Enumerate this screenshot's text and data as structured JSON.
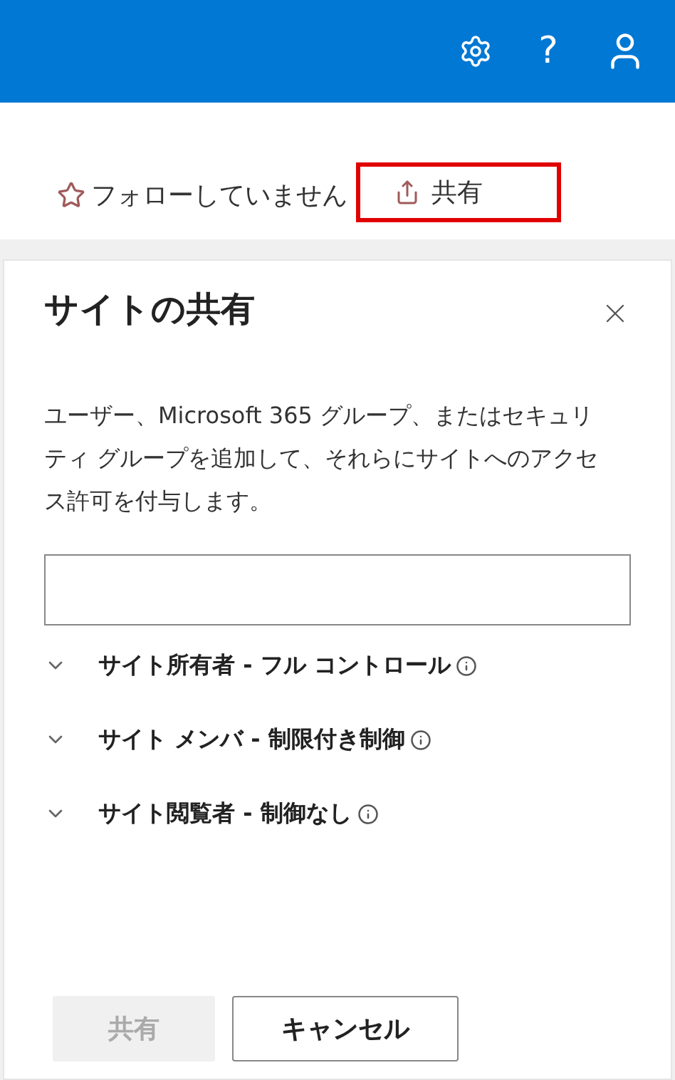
{
  "top_bar": {
    "help_glyph": "?"
  },
  "command_bar": {
    "follow": {
      "label": "フォローしていません",
      "following": false
    },
    "share": {
      "label": "共有",
      "highlighted": true
    }
  },
  "panel": {
    "title": "サイトの共有",
    "description": "ユーザー、Microsoft 365 グループ、またはセキュリティ グループを追加して、それらにサイトへのアクセス許可を付与します。",
    "groups": [
      {
        "label": "サイト所有者 - フル コントロール",
        "expanded": false
      },
      {
        "label": "サイト メンバ - 制限付き制御",
        "expanded": false
      },
      {
        "label": "サイト閲覧者 - 制御なし",
        "expanded": false
      }
    ],
    "buttons": [
      {
        "label": "共有",
        "kind": "primary",
        "disabled": true
      },
      {
        "label": "キャンセル",
        "kind": "secondary",
        "disabled": false
      }
    ]
  }
}
